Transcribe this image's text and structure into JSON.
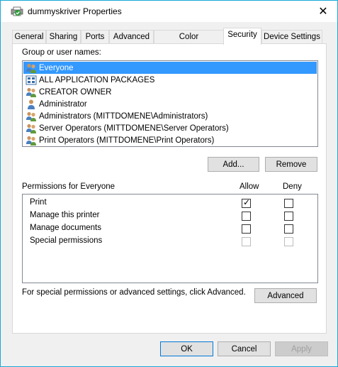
{
  "window": {
    "title": "dummyskriver Properties",
    "close_label": "✕"
  },
  "tabs": [
    {
      "label": "General"
    },
    {
      "label": "Sharing"
    },
    {
      "label": "Ports"
    },
    {
      "label": "Advanced"
    },
    {
      "label": "Color Management"
    },
    {
      "label": "Security",
      "active": true
    },
    {
      "label": "Device Settings"
    }
  ],
  "security": {
    "group_label": "Group or user names:",
    "users": [
      {
        "name": "Everyone",
        "icon": "users-group-icon",
        "selected": true
      },
      {
        "name": "ALL APPLICATION PACKAGES",
        "icon": "packages-icon"
      },
      {
        "name": "CREATOR OWNER",
        "icon": "users-group-icon"
      },
      {
        "name": "Administrator",
        "icon": "user-icon"
      },
      {
        "name": "Administrators (MITTDOMENE\\Administrators)",
        "icon": "users-group-icon"
      },
      {
        "name": "Server Operators (MITTDOMENE\\Server Operators)",
        "icon": "users-group-icon"
      },
      {
        "name": "Print Operators (MITTDOMENE\\Print Operators)",
        "icon": "users-group-icon"
      }
    ],
    "add_label": "Add...",
    "remove_label": "Remove",
    "permissions_label": "Permissions for Everyone",
    "allow_label": "Allow",
    "deny_label": "Deny",
    "permissions": [
      {
        "name": "Print",
        "allow": true,
        "deny": false,
        "disabled": false
      },
      {
        "name": "Manage this printer",
        "allow": false,
        "deny": false,
        "disabled": false
      },
      {
        "name": "Manage documents",
        "allow": false,
        "deny": false,
        "disabled": false
      },
      {
        "name": "Special permissions",
        "allow": false,
        "deny": false,
        "disabled": true
      }
    ],
    "advanced_hint": "For special permissions or advanced settings, click Advanced.",
    "advanced_label": "Advanced"
  },
  "footer": {
    "ok_label": "OK",
    "cancel_label": "Cancel",
    "apply_label": "Apply"
  },
  "colors": {
    "selection": "#3399ff",
    "window_border": "#18a8d8",
    "default_button_border": "#0078d7"
  }
}
